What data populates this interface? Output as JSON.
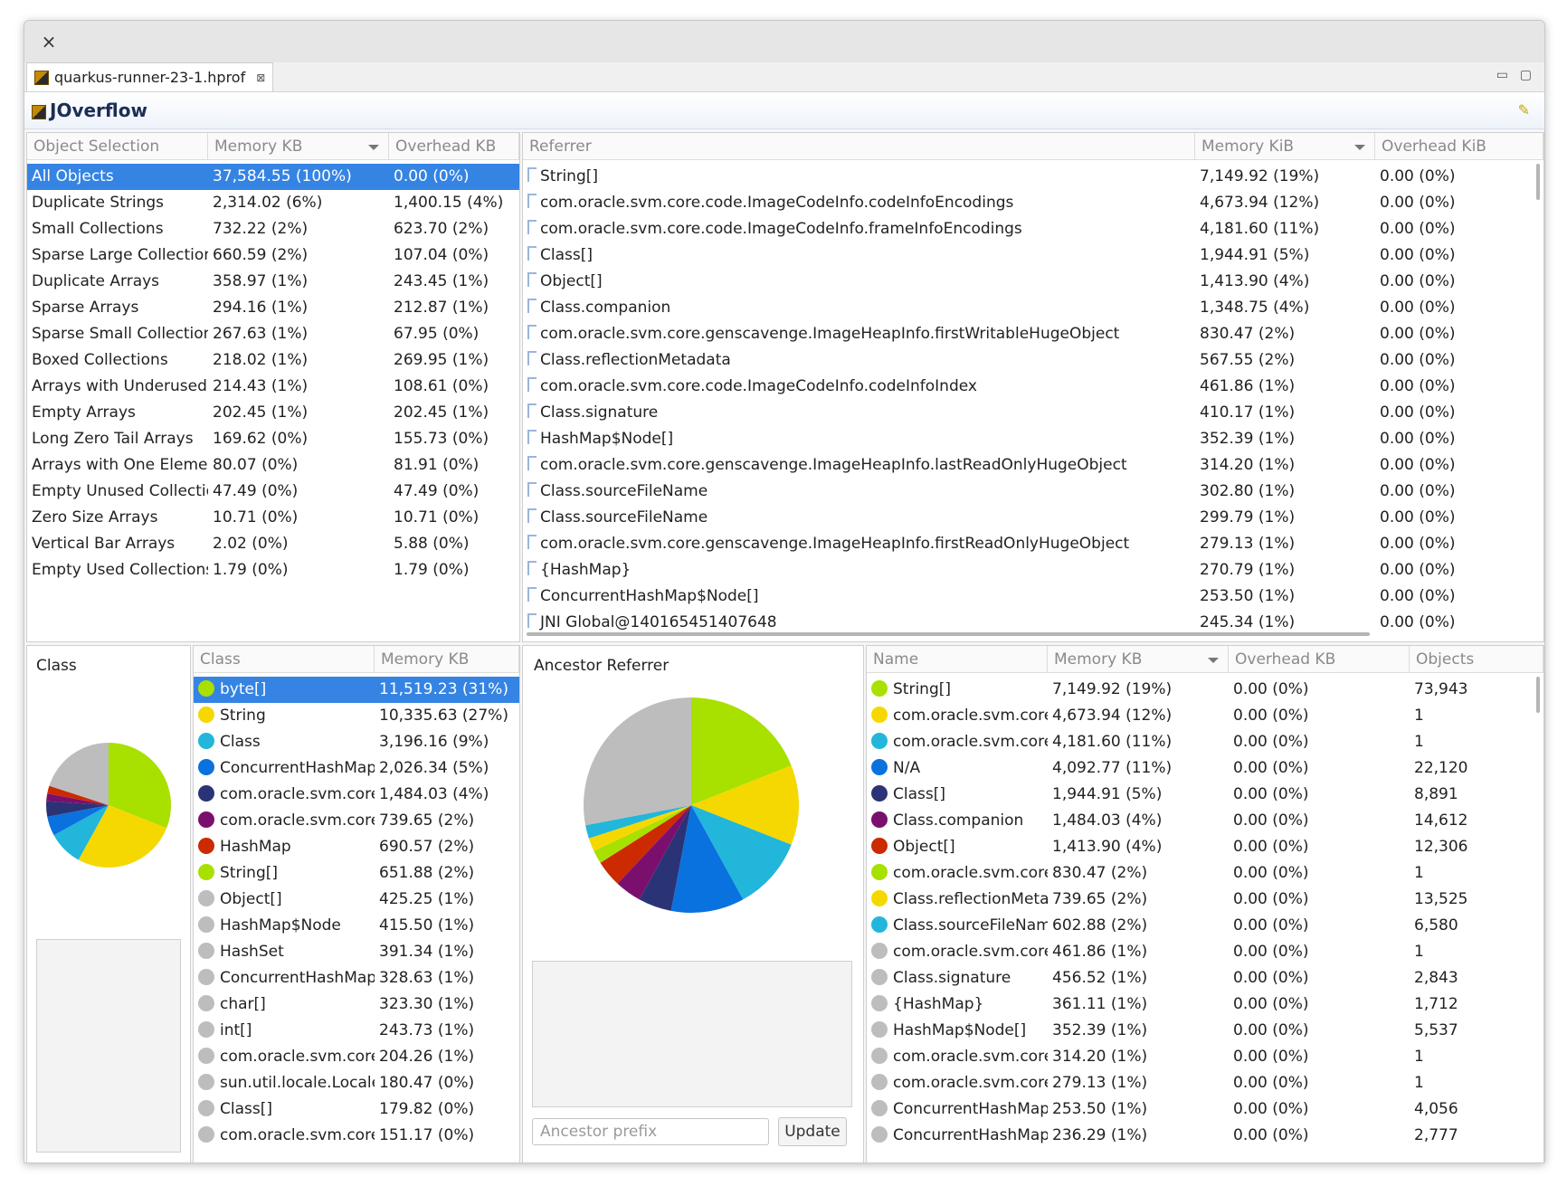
{
  "window": {
    "close_label": "×"
  },
  "editor_tab": {
    "title": "quarkus-runner-23-1.hprof",
    "close_label": "⊠"
  },
  "window_controls": {
    "minimize": "▭",
    "maximize": "▢"
  },
  "app": {
    "title": "JOverflow",
    "pin_glyph": "✎"
  },
  "object_selection": {
    "headers": {
      "name": "Object Selection",
      "memory": "Memory KB",
      "overhead": "Overhead KB"
    },
    "rows": [
      {
        "name": "All Objects",
        "memory": "37,584.55 (100%)",
        "overhead": "0.00 (0%)"
      },
      {
        "name": "Duplicate Strings",
        "memory": "2,314.02 (6%)",
        "overhead": "1,400.15 (4%)"
      },
      {
        "name": "Small Collections",
        "memory": "732.22 (2%)",
        "overhead": "623.70 (2%)"
      },
      {
        "name": "Sparse Large Collections",
        "memory": "660.59 (2%)",
        "overhead": "107.04 (0%)"
      },
      {
        "name": "Duplicate Arrays",
        "memory": "358.97 (1%)",
        "overhead": "243.45 (1%)"
      },
      {
        "name": "Sparse Arrays",
        "memory": "294.16 (1%)",
        "overhead": "212.87 (1%)"
      },
      {
        "name": "Sparse Small Collections",
        "memory": "267.63 (1%)",
        "overhead": "67.95 (0%)"
      },
      {
        "name": "Boxed Collections",
        "memory": "218.02 (1%)",
        "overhead": "269.95 (1%)"
      },
      {
        "name": "Arrays with Underused Elements",
        "memory": "214.43 (1%)",
        "overhead": "108.61 (0%)"
      },
      {
        "name": "Empty Arrays",
        "memory": "202.45 (1%)",
        "overhead": "202.45 (1%)"
      },
      {
        "name": "Long Zero Tail Arrays",
        "memory": "169.62 (0%)",
        "overhead": "155.73 (0%)"
      },
      {
        "name": "Arrays with One Element",
        "memory": "80.07 (0%)",
        "overhead": "81.91 (0%)"
      },
      {
        "name": "Empty Unused Collections",
        "memory": "47.49 (0%)",
        "overhead": "47.49 (0%)"
      },
      {
        "name": "Zero Size Arrays",
        "memory": "10.71 (0%)",
        "overhead": "10.71 (0%)"
      },
      {
        "name": "Vertical Bar Arrays",
        "memory": "2.02 (0%)",
        "overhead": "5.88 (0%)"
      },
      {
        "name": "Empty Used Collections",
        "memory": "1.79 (0%)",
        "overhead": "1.79 (0%)"
      }
    ]
  },
  "referrer": {
    "headers": {
      "name": "Referrer",
      "memory": "Memory KiB",
      "overhead": "Overhead KiB"
    },
    "rows": [
      {
        "name": "String[]",
        "memory": "7,149.92 (19%)",
        "overhead": "0.00 (0%)"
      },
      {
        "name": "com.oracle.svm.core.code.ImageCodeInfo.codeInfoEncodings",
        "memory": "4,673.94 (12%)",
        "overhead": "0.00 (0%)"
      },
      {
        "name": "com.oracle.svm.core.code.ImageCodeInfo.frameInfoEncodings",
        "memory": "4,181.60 (11%)",
        "overhead": "0.00 (0%)"
      },
      {
        "name": "Class[]",
        "memory": "1,944.91 (5%)",
        "overhead": "0.00 (0%)"
      },
      {
        "name": "Object[]",
        "memory": "1,413.90 (4%)",
        "overhead": "0.00 (0%)"
      },
      {
        "name": "Class.companion",
        "memory": "1,348.75 (4%)",
        "overhead": "0.00 (0%)"
      },
      {
        "name": "com.oracle.svm.core.genscavenge.ImageHeapInfo.firstWritableHugeObject",
        "memory": "830.47 (2%)",
        "overhead": "0.00 (0%)"
      },
      {
        "name": "Class.reflectionMetadata",
        "memory": "567.55 (2%)",
        "overhead": "0.00 (0%)"
      },
      {
        "name": "com.oracle.svm.core.code.ImageCodeInfo.codeInfoIndex",
        "memory": "461.86 (1%)",
        "overhead": "0.00 (0%)"
      },
      {
        "name": "Class.signature",
        "memory": "410.17 (1%)",
        "overhead": "0.00 (0%)"
      },
      {
        "name": "HashMap$Node[]",
        "memory": "352.39 (1%)",
        "overhead": "0.00 (0%)"
      },
      {
        "name": "com.oracle.svm.core.genscavenge.ImageHeapInfo.lastReadOnlyHugeObject",
        "memory": "314.20 (1%)",
        "overhead": "0.00 (0%)"
      },
      {
        "name": "Class.sourceFileName",
        "memory": "302.80 (1%)",
        "overhead": "0.00 (0%)"
      },
      {
        "name": "Class.sourceFileName",
        "memory": "299.79 (1%)",
        "overhead": "0.00 (0%)"
      },
      {
        "name": "com.oracle.svm.core.genscavenge.ImageHeapInfo.firstReadOnlyHugeObject",
        "memory": "279.13 (1%)",
        "overhead": "0.00 (0%)"
      },
      {
        "name": "{HashMap}",
        "memory": "270.79 (1%)",
        "overhead": "0.00 (0%)"
      },
      {
        "name": "ConcurrentHashMap$Node[]",
        "memory": "253.50 (1%)",
        "overhead": "0.00 (0%)"
      },
      {
        "name": "JNI Global@140165451407648",
        "memory": "245.34 (1%)",
        "overhead": "0.00 (0%)"
      }
    ]
  },
  "class_chart": {
    "title": "Class",
    "slices": [
      {
        "value": 31,
        "color": "#a8e000"
      },
      {
        "value": 27,
        "color": "#f5d800"
      },
      {
        "value": 9,
        "color": "#22b6da"
      },
      {
        "value": 5,
        "color": "#0a72de"
      },
      {
        "value": 4,
        "color": "#2a3376"
      },
      {
        "value": 2,
        "color": "#7b0f6e"
      },
      {
        "value": 2,
        "color": "#cc2a00"
      },
      {
        "value": 20,
        "color": "#bdbdbd"
      }
    ]
  },
  "class_table": {
    "headers": {
      "name": "Class",
      "memory": "Memory KB"
    },
    "rows": [
      {
        "name": "byte[]",
        "memory": "11,519.23 (31%)",
        "color": "#a8e000"
      },
      {
        "name": "String",
        "memory": "10,335.63 (27%)",
        "color": "#f5d800"
      },
      {
        "name": "Class",
        "memory": "3,196.16 (9%)",
        "color": "#22b6da"
      },
      {
        "name": "ConcurrentHashMap$Node",
        "memory": "2,026.34 (5%)",
        "color": "#0a72de"
      },
      {
        "name": "com.oracle.svm.core.hub.DynamicHubCompanion",
        "memory": "1,484.03 (4%)",
        "color": "#2a3376"
      },
      {
        "name": "com.oracle.svm.core.reflect.ReflectionMetadata",
        "memory": "739.65 (2%)",
        "color": "#7b0f6e"
      },
      {
        "name": "HashMap",
        "memory": "690.57 (2%)",
        "color": "#cc2a00"
      },
      {
        "name": "String[]",
        "memory": "651.88 (2%)",
        "color": "#a8e000"
      },
      {
        "name": "Object[]",
        "memory": "425.25 (1%)",
        "color": "#bdbdbd"
      },
      {
        "name": "HashMap$Node",
        "memory": "415.50 (1%)",
        "color": "#bdbdbd"
      },
      {
        "name": "HashSet",
        "memory": "391.34 (1%)",
        "color": "#bdbdbd"
      },
      {
        "name": "ConcurrentHashMap$Node[]",
        "memory": "328.63 (1%)",
        "color": "#bdbdbd"
      },
      {
        "name": "char[]",
        "memory": "323.30 (1%)",
        "color": "#bdbdbd"
      },
      {
        "name": "int[]",
        "memory": "243.73 (1%)",
        "color": "#bdbdbd"
      },
      {
        "name": "com.oracle.svm.core.hub.DynamicHub",
        "memory": "204.26 (1%)",
        "color": "#bdbdbd"
      },
      {
        "name": "sun.util.locale.LocaleObjectCache",
        "memory": "180.47 (0%)",
        "color": "#bdbdbd"
      },
      {
        "name": "Class[]",
        "memory": "179.82 (0%)",
        "color": "#bdbdbd"
      },
      {
        "name": "com.oracle.svm.core.code.CodeInfo",
        "memory": "151.17 (0%)",
        "color": "#bdbdbd"
      }
    ]
  },
  "ancestor": {
    "title": "Ancestor Referrer",
    "input_placeholder": "Ancestor prefix",
    "update_label": "Update",
    "slices": [
      {
        "value": 19,
        "color": "#a8e000"
      },
      {
        "value": 12,
        "color": "#f5d800"
      },
      {
        "value": 11,
        "color": "#22b6da"
      },
      {
        "value": 11,
        "color": "#0a72de"
      },
      {
        "value": 5,
        "color": "#2a3376"
      },
      {
        "value": 4,
        "color": "#7b0f6e"
      },
      {
        "value": 4,
        "color": "#cc2a00"
      },
      {
        "value": 2,
        "color": "#a8e000"
      },
      {
        "value": 2,
        "color": "#f5d800"
      },
      {
        "value": 2,
        "color": "#22b6da"
      },
      {
        "value": 28,
        "color": "#bdbdbd"
      }
    ]
  },
  "name_table": {
    "headers": {
      "name": "Name",
      "memory": "Memory KB",
      "overhead": "Overhead KB",
      "objects": "Objects"
    },
    "rows": [
      {
        "name": "String[]",
        "memory": "7,149.92 (19%)",
        "overhead": "0.00 (0%)",
        "objects": "73,943",
        "color": "#a8e000"
      },
      {
        "name": "com.oracle.svm.core.code.ImageCodeInfo.codeInfoEncodings",
        "memory": "4,673.94 (12%)",
        "overhead": "0.00 (0%)",
        "objects": "1",
        "color": "#f5d800"
      },
      {
        "name": "com.oracle.svm.core.code.ImageCodeInfo.frameInfoEncodings",
        "memory": "4,181.60 (11%)",
        "overhead": "0.00 (0%)",
        "objects": "1",
        "color": "#22b6da"
      },
      {
        "name": "N/A",
        "memory": "4,092.77 (11%)",
        "overhead": "0.00 (0%)",
        "objects": "22,120",
        "color": "#0a72de"
      },
      {
        "name": "Class[]",
        "memory": "1,944.91 (5%)",
        "overhead": "0.00 (0%)",
        "objects": "8,891",
        "color": "#2a3376"
      },
      {
        "name": "Class.companion",
        "memory": "1,484.03 (4%)",
        "overhead": "0.00 (0%)",
        "objects": "14,612",
        "color": "#7b0f6e"
      },
      {
        "name": "Object[]",
        "memory": "1,413.90 (4%)",
        "overhead": "0.00 (0%)",
        "objects": "12,306",
        "color": "#cc2a00"
      },
      {
        "name": "com.oracle.svm.core.genscavenge.ImageHeapInfo.firstWritableHugeObject",
        "memory": "830.47 (2%)",
        "overhead": "0.00 (0%)",
        "objects": "1",
        "color": "#a8e000"
      },
      {
        "name": "Class.reflectionMetadata",
        "memory": "739.65 (2%)",
        "overhead": "0.00 (0%)",
        "objects": "13,525",
        "color": "#f5d800"
      },
      {
        "name": "Class.sourceFileName",
        "memory": "602.88 (2%)",
        "overhead": "0.00 (0%)",
        "objects": "6,580",
        "color": "#22b6da"
      },
      {
        "name": "com.oracle.svm.core.code.ImageCodeInfo.codeInfoIndex",
        "memory": "461.86 (1%)",
        "overhead": "0.00 (0%)",
        "objects": "1",
        "color": "#bdbdbd"
      },
      {
        "name": "Class.signature",
        "memory": "456.52 (1%)",
        "overhead": "0.00 (0%)",
        "objects": "2,843",
        "color": "#bdbdbd"
      },
      {
        "name": "{HashMap}",
        "memory": "361.11 (1%)",
        "overhead": "0.00 (0%)",
        "objects": "1,712",
        "color": "#bdbdbd"
      },
      {
        "name": "HashMap$Node[]",
        "memory": "352.39 (1%)",
        "overhead": "0.00 (0%)",
        "objects": "5,537",
        "color": "#bdbdbd"
      },
      {
        "name": "com.oracle.svm.core.genscavenge.ImageHeapInfo.lastReadOnlyHugeObject",
        "memory": "314.20 (1%)",
        "overhead": "0.00 (0%)",
        "objects": "1",
        "color": "#bdbdbd"
      },
      {
        "name": "com.oracle.svm.core.genscavenge.ImageHeapInfo.firstReadOnlyHugeObject",
        "memory": "279.13 (1%)",
        "overhead": "0.00 (0%)",
        "objects": "1",
        "color": "#bdbdbd"
      },
      {
        "name": "ConcurrentHashMap$Node[]",
        "memory": "253.50 (1%)",
        "overhead": "0.00 (0%)",
        "objects": "4,056",
        "color": "#bdbdbd"
      },
      {
        "name": "ConcurrentHashMap$Node",
        "memory": "236.29 (1%)",
        "overhead": "0.00 (0%)",
        "objects": "2,777",
        "color": "#bdbdbd"
      }
    ]
  }
}
